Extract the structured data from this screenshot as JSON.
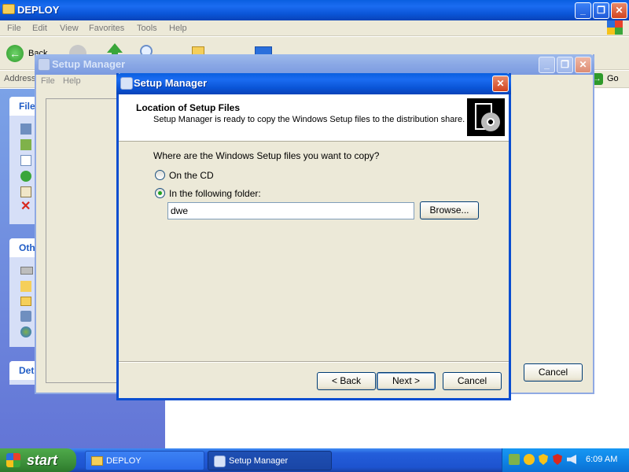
{
  "deploy_window": {
    "title": "DEPLOY",
    "menu": [
      "File",
      "Edit",
      "View",
      "Favorites",
      "Tools",
      "Help"
    ],
    "toolbar": {
      "back_label": "Back",
      "search_label": "Search",
      "folders_label": "Folders"
    },
    "address_label": "Address",
    "go_label": "Go",
    "taskpane": {
      "section1": "File",
      "section2": "Oth",
      "section3": "Det"
    }
  },
  "setup_manager_bg": {
    "title": "Setup Manager",
    "menu": [
      "File",
      "Help"
    ],
    "cancel_label": "Cancel"
  },
  "dialog": {
    "title": "Setup Manager",
    "header_title": "Location of Setup Files",
    "header_subtitle": "Setup Manager is ready to copy the Windows Setup files to the distribution share.",
    "question": "Where are the Windows Setup files you want to copy?",
    "option_cd": "On the CD",
    "option_folder": "In the following folder:",
    "selected_option": "folder",
    "folder_value": "dwe",
    "browse_label": "Browse...",
    "back_label": "< Back",
    "next_label": "Next >",
    "cancel_label": "Cancel"
  },
  "taskbar": {
    "start_label": "start",
    "tasks": [
      "DEPLOY",
      "Setup Manager"
    ],
    "clock": "6:09 AM"
  },
  "colors": {
    "xp_blue": "#0a54d6",
    "dialog_face": "#ece9d8",
    "start_green": "#3c8f3a"
  }
}
